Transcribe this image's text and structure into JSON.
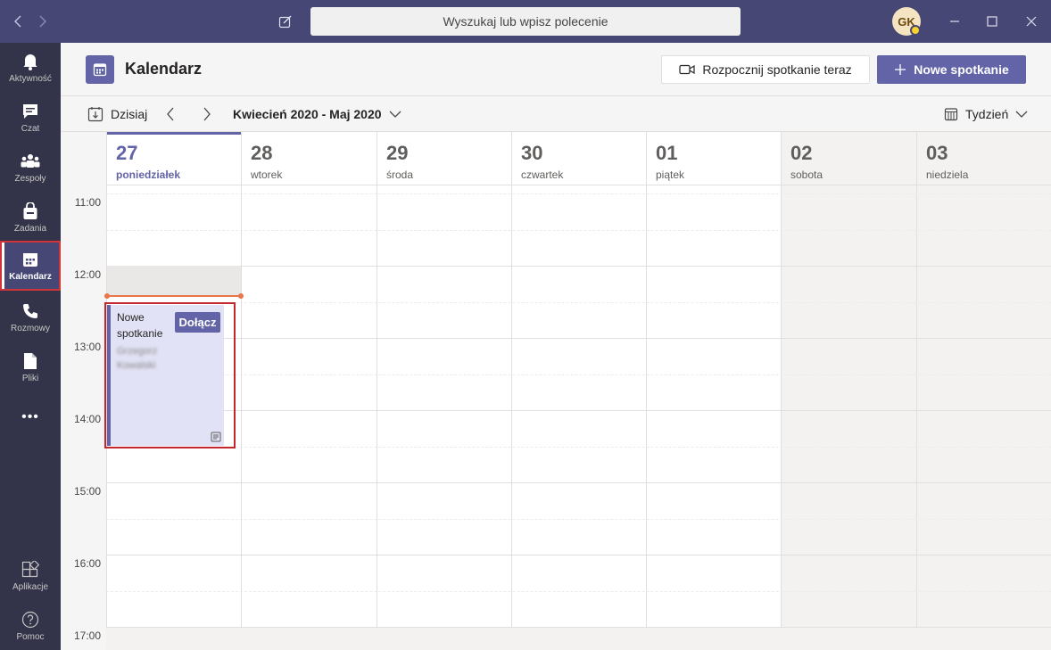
{
  "titlebar": {
    "search_placeholder": "Wyszukaj lub wpisz polecenie",
    "avatar_initials": "GK"
  },
  "rail": {
    "items": [
      {
        "label": "Aktywność",
        "icon": "bell-icon"
      },
      {
        "label": "Czat",
        "icon": "chat-icon"
      },
      {
        "label": "Zespoły",
        "icon": "teams-icon"
      },
      {
        "label": "Zadania",
        "icon": "bag-icon"
      },
      {
        "label": "Kalendarz",
        "icon": "calendar-icon",
        "active": true
      },
      {
        "label": "Rozmowy",
        "icon": "phone-icon"
      },
      {
        "label": "Pliki",
        "icon": "file-icon"
      },
      {
        "label": "Aplikacje",
        "icon": "apps-icon"
      },
      {
        "label": "Pomoc",
        "icon": "help-icon"
      }
    ],
    "more": "•••"
  },
  "header": {
    "title": "Kalendarz",
    "meet_now": "Rozpocznij spotkanie teraz",
    "new_meeting": "Nowe spotkanie"
  },
  "toolbar": {
    "today": "Dzisiaj",
    "range": "Kwiecień 2020 - Maj 2020",
    "view": "Tydzień"
  },
  "days": [
    {
      "num": "27",
      "name": "poniedziałek"
    },
    {
      "num": "28",
      "name": "wtorek"
    },
    {
      "num": "29",
      "name": "środa"
    },
    {
      "num": "30",
      "name": "czwartek"
    },
    {
      "num": "01",
      "name": "piątek"
    },
    {
      "num": "02",
      "name": "sobota"
    },
    {
      "num": "03",
      "name": "niedziela"
    }
  ],
  "times": [
    "11:00",
    "12:00",
    "13:00",
    "14:00",
    "15:00",
    "16:00",
    "17:00"
  ],
  "event": {
    "title": "Nowe spotkanie",
    "organizer": "Grzegorz Kowalski",
    "join": "Dołącz"
  },
  "colors": {
    "accent": "#6264a7",
    "titlebar": "#464775",
    "rail": "#33344a",
    "now_line": "#e97548",
    "highlight": "#c4262e"
  }
}
